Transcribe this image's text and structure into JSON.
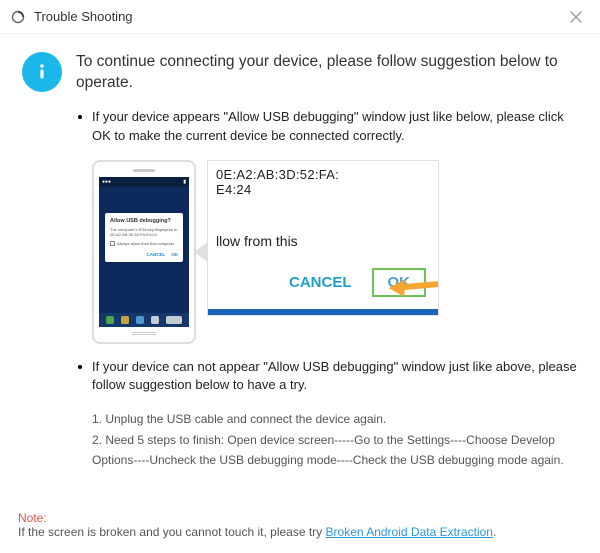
{
  "titlebar": {
    "title": "Trouble Shooting"
  },
  "intro": {
    "text": "To continue connecting your device, please follow suggestion below to operate."
  },
  "section1": {
    "text": "If your device appears \"Allow USB debugging\" window just like below, please click OK to make the current device  be connected correctly."
  },
  "phone_dialog": {
    "title": "Allow USB debugging?",
    "body": "The computer's RSA key fingerprint is:\n0E:A2:AB:3D:52:FA:E4:24",
    "checkbox": "Always allow from this computer",
    "cancel": "CANCEL",
    "ok": "OK"
  },
  "zoom": {
    "line1": "0E:A2:AB:3D:52:FA:",
    "line2": "E4:24",
    "line3": "llow from this",
    "cancel": "CANCEL",
    "ok": "OK"
  },
  "section2": {
    "text": "If your device can not appear \"Allow USB debugging\" window just like above, please follow suggestion below to have a try."
  },
  "steps": {
    "s1": "1. Unplug the USB cable and connect the device again.",
    "s2": "2. Need 5 steps to finish: Open device screen-----Go to the Settings----Choose Develop Options----Uncheck the USB debugging mode----Check the USB debugging mode again."
  },
  "footer": {
    "note": "Note:",
    "text": "If the screen is broken and you cannot touch it, please try ",
    "link": "Broken Android Data Extraction",
    "suffix": "."
  }
}
